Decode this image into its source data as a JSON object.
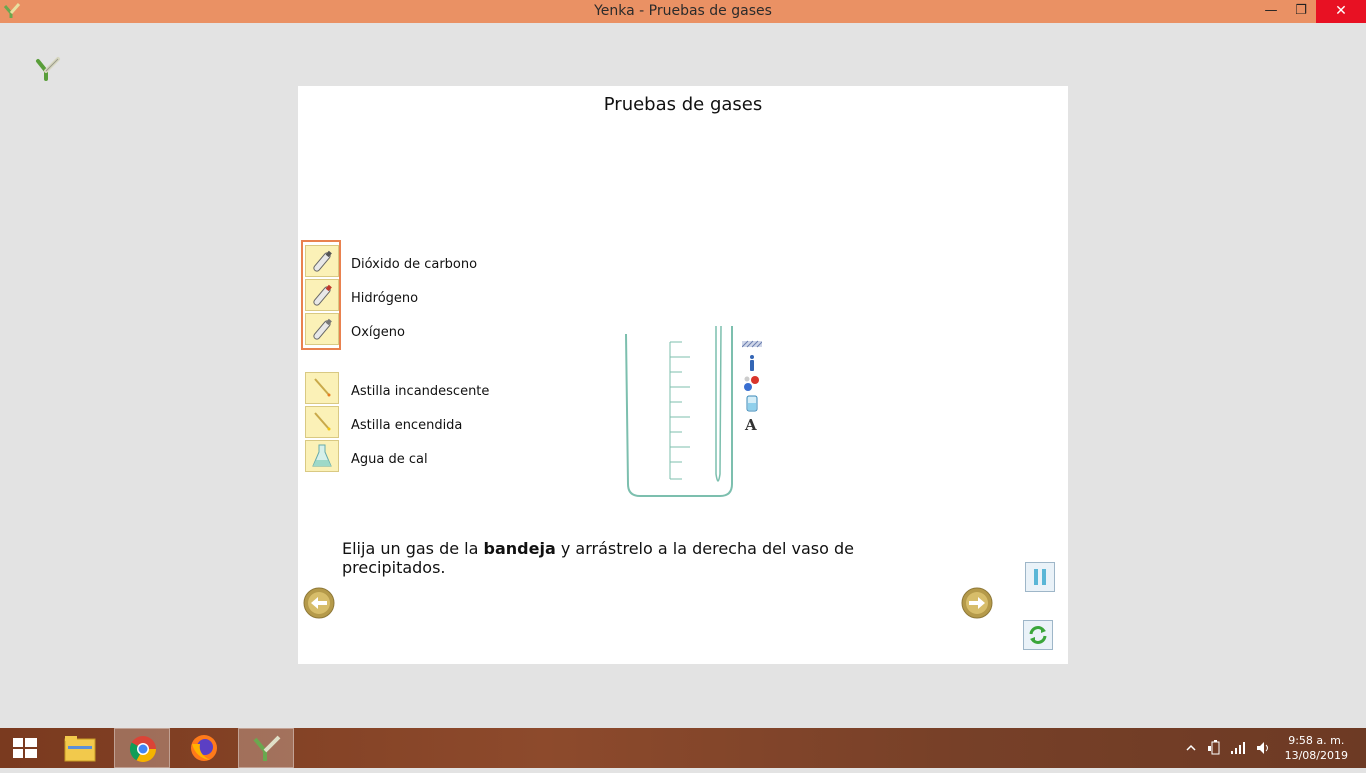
{
  "window": {
    "title": "Yenka - Pruebas de gases",
    "minimize": "—",
    "restore": "❐",
    "close": "✕"
  },
  "page": {
    "title": "Pruebas de gases"
  },
  "gases": [
    {
      "label": "Dióxido de carbono",
      "icon": "gas-cylinder-icon"
    },
    {
      "label": "Hidrógeno",
      "icon": "gas-cylinder-red-icon"
    },
    {
      "label": "Oxígeno",
      "icon": "gas-cylinder-icon"
    }
  ],
  "tests": [
    {
      "label": "Astilla incandescente",
      "icon": "splint-icon"
    },
    {
      "label": "Astilla encendida",
      "icon": "splint-icon"
    },
    {
      "label": "Agua de cal",
      "icon": "flask-icon"
    }
  ],
  "instruction": {
    "before": "Elija un gas de la ",
    "bold": "bandeja",
    "after": " y arrástrelo a la derecha del vaso de precipitados."
  },
  "taskbar": {
    "time": "9:58 a. m.",
    "date": "13/08/2019"
  },
  "colors": {
    "titlebar": "#ea9164",
    "tray_border": "#e9814f",
    "close": "#e81123"
  }
}
